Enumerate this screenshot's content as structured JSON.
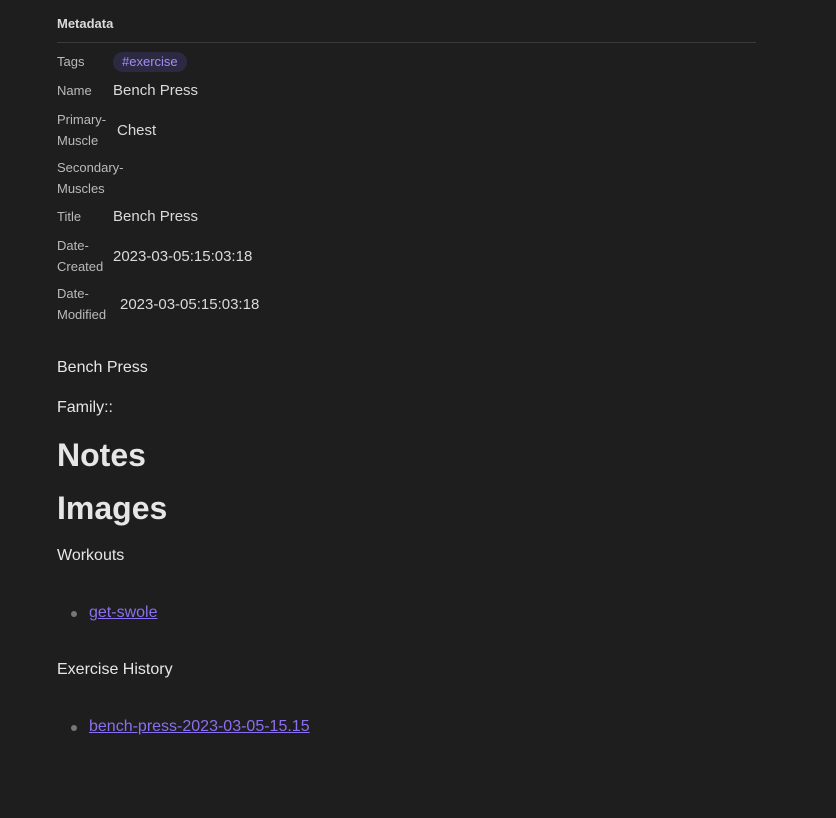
{
  "metadata": {
    "header": "Metadata",
    "properties": [
      {
        "key": "Tags",
        "value": "#exercise"
      },
      {
        "key": "Name",
        "value": "Bench Press"
      },
      {
        "key": "Primary-\nMuscle",
        "value": "Chest"
      },
      {
        "key": "Secondary-\nMuscles",
        "value": ""
      },
      {
        "key": "Title",
        "value": "Bench Press"
      },
      {
        "key": "Date-\nCreated",
        "value": "2023-03-05:15:03:18"
      },
      {
        "key": "Date-\nModified",
        "value": "2023-03-05:15:03:18"
      }
    ]
  },
  "content": {
    "intro": "Bench Press",
    "family": "Family::",
    "notes_heading": "Notes",
    "images_heading": "Images",
    "workouts_label": "Workouts",
    "workout_links": [
      "get-swole"
    ],
    "history_label": "Exercise History",
    "history_links": [
      "bench-press-2023-03-05-15.15"
    ]
  },
  "colors": {
    "background": "#1e1e1e",
    "link": "#8a6ff0",
    "tag_bg": "#2c2943",
    "tag_text": "#a48df2"
  }
}
